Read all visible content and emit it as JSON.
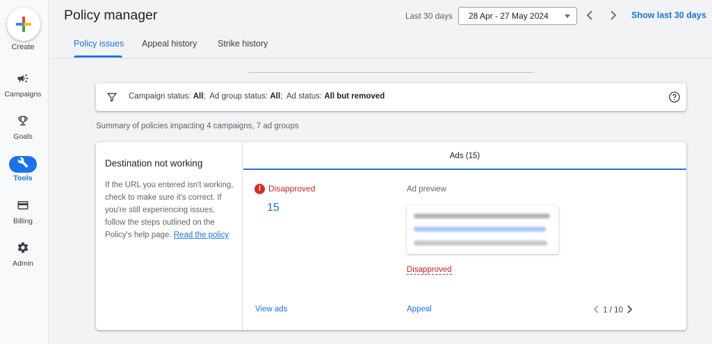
{
  "sidebar": {
    "create_label": "Create",
    "items": [
      {
        "label": "Campaigns",
        "icon": "megaphone-icon"
      },
      {
        "label": "Goals",
        "icon": "trophy-icon"
      },
      {
        "label": "Tools",
        "icon": "tools-icon",
        "active": true
      },
      {
        "label": "Billing",
        "icon": "credit-card-icon"
      },
      {
        "label": "Admin",
        "icon": "gear-icon"
      }
    ]
  },
  "header": {
    "title": "Policy manager",
    "range_label": "Last 30 days",
    "date_range": "28 Apr - 27 May 2024",
    "show_last_label": "Show last 30 days"
  },
  "tabs": [
    {
      "label": "Policy issues",
      "active": true
    },
    {
      "label": "Appeal history"
    },
    {
      "label": "Strike history"
    }
  ],
  "filter": {
    "campaign_status_label": "Campaign status:",
    "campaign_status_value": "All",
    "ad_group_status_label": "Ad group status:",
    "ad_group_status_value": "All",
    "ad_status_label": "Ad status:",
    "ad_status_value": "All but removed"
  },
  "summary": "Summary of policies impacting 4 campaigns, 7 ad groups",
  "policy": {
    "title": "Destination not working",
    "description": "If the URL you entered isn't working, check to make sure it's correct. If you're still experiencing issues, follow the steps outlined on the Policy's help page.",
    "link": "Read the policy",
    "ads_header": "Ads (15)",
    "status": "Disapproved",
    "count": "15",
    "preview_label": "Ad preview",
    "preview_status": "Disapproved",
    "view_ads": "View ads",
    "appeal": "Appeal",
    "pager": "1 / 10"
  },
  "colors": {
    "accent": "#1a73e8",
    "error": "#d93025"
  }
}
